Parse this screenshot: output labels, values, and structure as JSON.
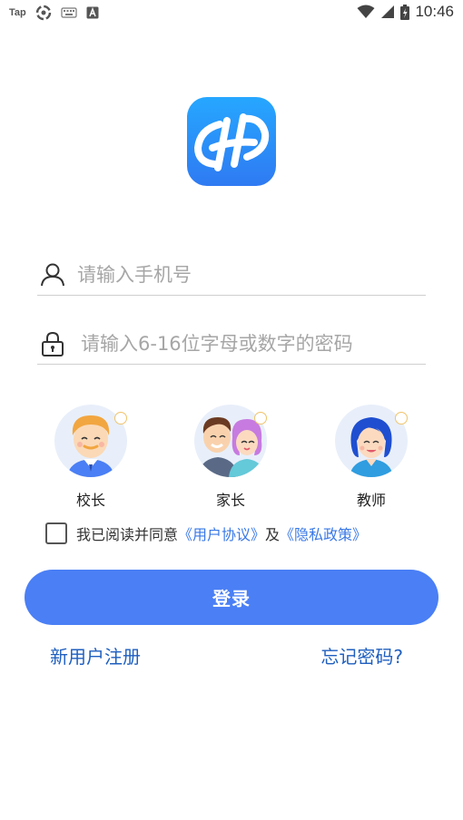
{
  "status_bar": {
    "tap_label": "Tap",
    "time": "10:46"
  },
  "login": {
    "phone_placeholder": "请输入手机号",
    "password_placeholder": "请输入6-16位字母或数字的密码",
    "roles": [
      {
        "label": "校长"
      },
      {
        "label": "家长"
      },
      {
        "label": "教师"
      }
    ],
    "agreement": {
      "prefix": "我已阅读并同意",
      "user_agreement": "《用户协议》",
      "and": "及",
      "privacy_policy": "《隐私政策》"
    },
    "login_button": "登录",
    "register_link": "新用户注册",
    "forgot_link": "忘记密码?"
  },
  "colors": {
    "primary": "#4a7ff5",
    "link": "#3a78e6",
    "bottom_link": "#1f5fbf",
    "logo_top": "#26a7ff",
    "logo_bottom": "#2f7af2"
  }
}
